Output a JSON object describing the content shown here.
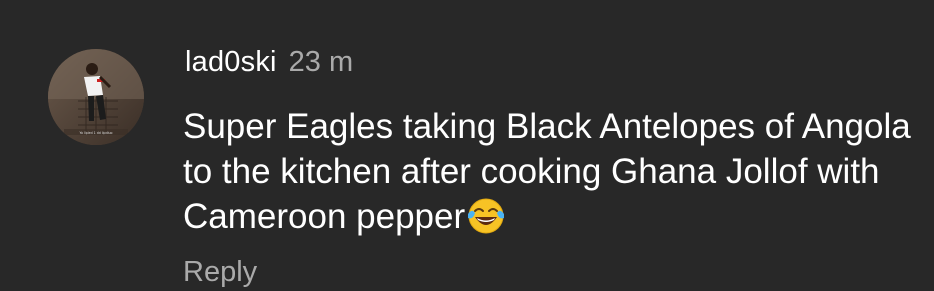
{
  "comment": {
    "author": "lad0ski",
    "time": "23 m",
    "text": "Super Eagles taking Black Antelopes of Angola to the kitchen after cooking Ghana Jollof with Cameroon pepper",
    "emoji": "face-with-tears-of-joy",
    "reply_label": "Reply",
    "avatar_caption": "Yo lipied 1 dd lipdiuo"
  },
  "colors": {
    "background": "#282828",
    "text_primary": "#ffffff",
    "text_secondary": "#aaaaaa"
  }
}
